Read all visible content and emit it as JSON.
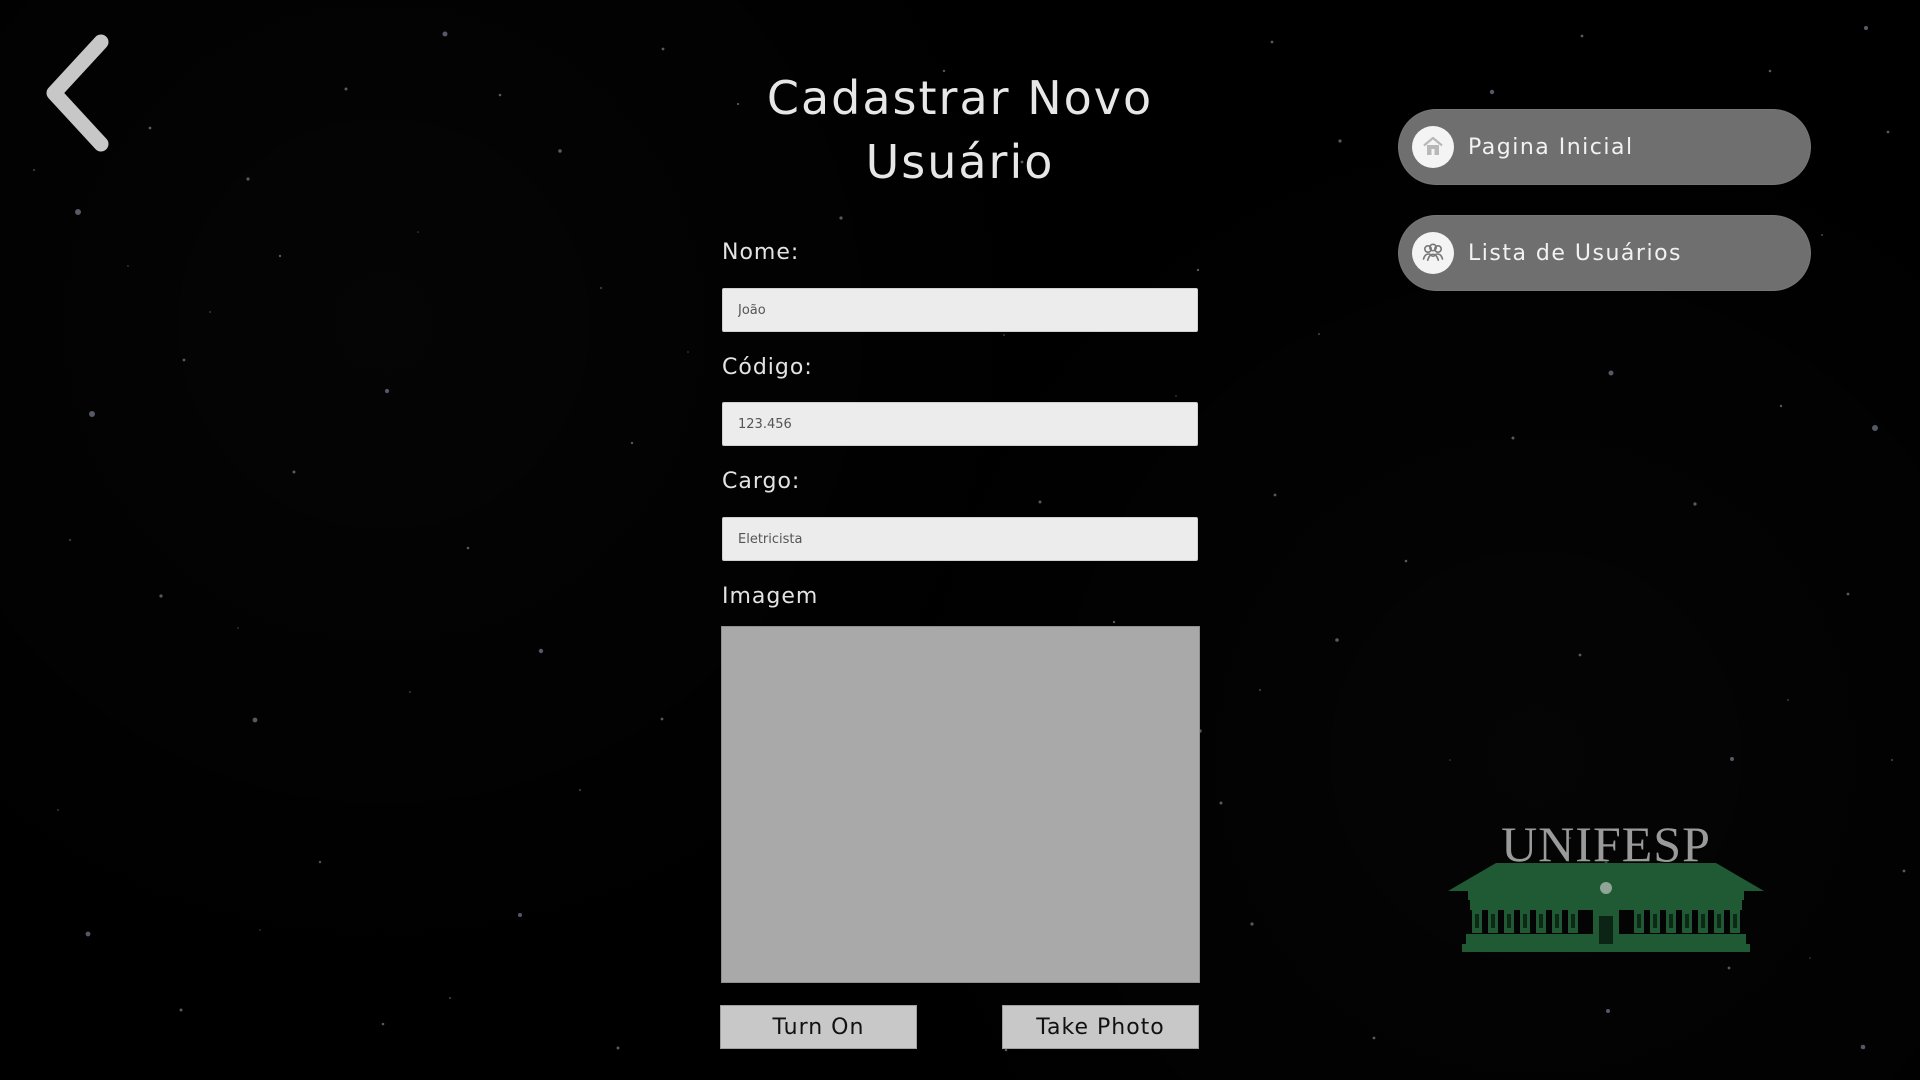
{
  "header": {
    "title_line_1": "Cadastrar Novo",
    "title_line_2": "Usuário"
  },
  "form": {
    "name_label": "Nome:",
    "name_value": "João",
    "code_label": "Código:",
    "code_value": "123.456",
    "role_label": "Cargo:",
    "role_value": "Eletricista",
    "image_label": "Imagem"
  },
  "buttons": {
    "turn_on": "Turn On",
    "take_photo": "Take Photo"
  },
  "navigation": {
    "home": "Pagina Inicial",
    "users": "Lista de Usuários"
  },
  "logo": {
    "text": "UNIFESP"
  },
  "icons": {
    "back": "chevron-left-icon",
    "home": "home-icon",
    "users": "users-icon"
  },
  "colors": {
    "background": "#000000",
    "pill": "#6f6f6f",
    "input": "#ececec",
    "image_placeholder": "#a9a9a9",
    "logo_green": "#1f5a35"
  }
}
